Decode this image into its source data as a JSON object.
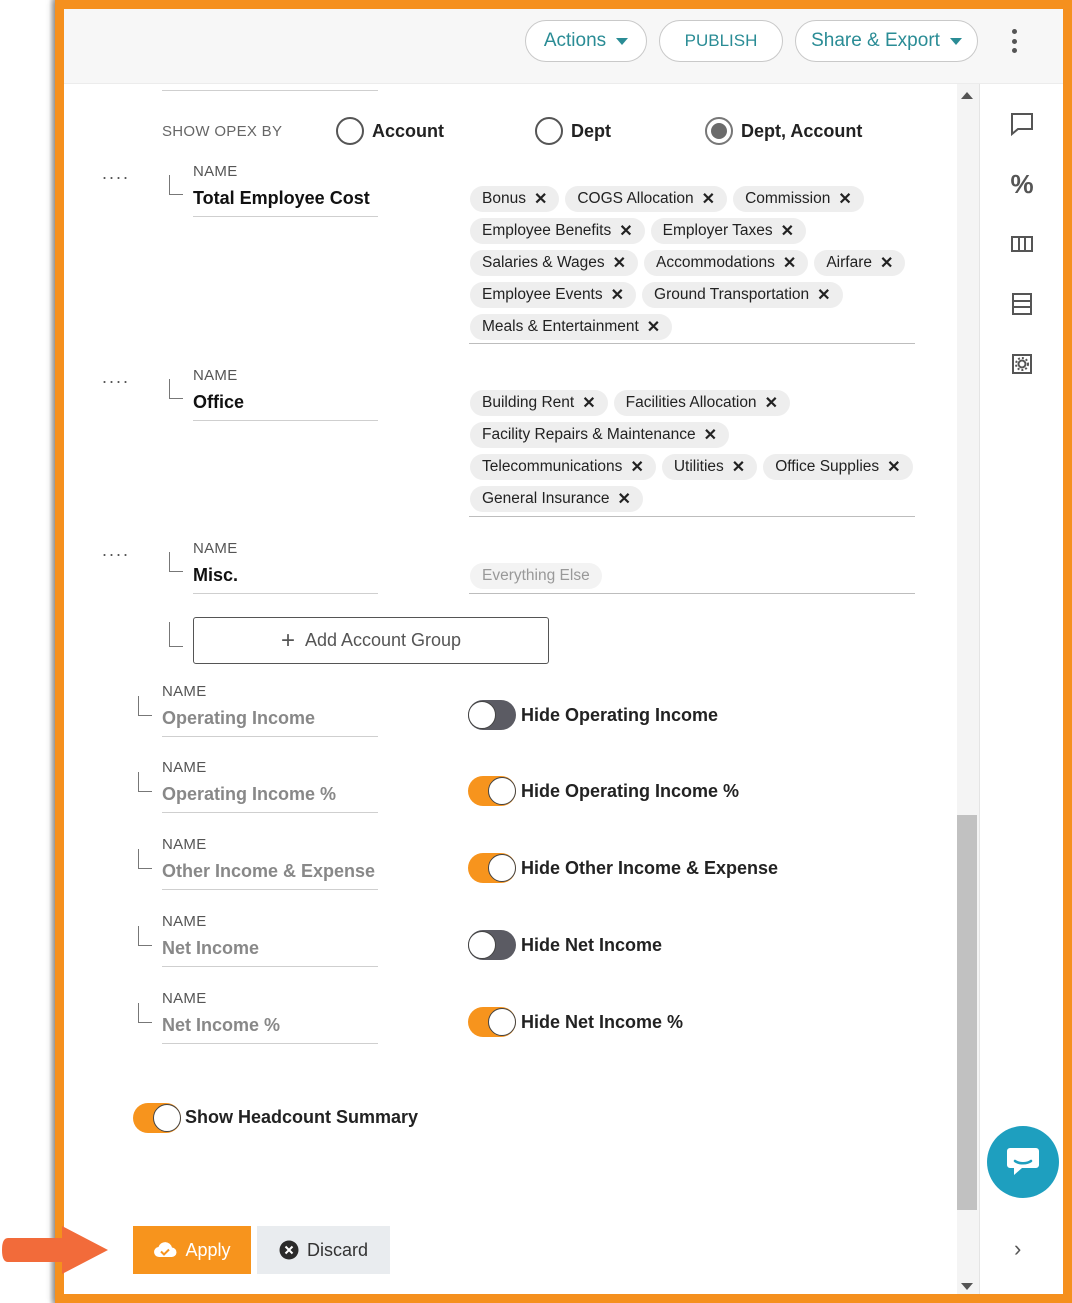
{
  "header": {
    "actions_label": "Actions",
    "publish_label": "PUBLISH",
    "share_export_label": "Share & Export"
  },
  "show_opex": {
    "label": "SHOW OPEX BY",
    "options": [
      "Account",
      "Dept",
      "Dept, Account"
    ],
    "selected": "Dept, Account"
  },
  "groups": [
    {
      "name_caption": "NAME",
      "name": "Total Employee Cost",
      "accounts": [
        "Bonus",
        "COGS Allocation",
        "Commission",
        "Employee Benefits",
        "Employer Taxes",
        "Salaries & Wages",
        "Accommodations",
        "Airfare",
        "Employee Events",
        "Ground Transportation",
        "Meals & Entertainment"
      ]
    },
    {
      "name_caption": "NAME",
      "name": "Office",
      "accounts": [
        "Building Rent",
        "Facilities Allocation",
        "Facility Repairs & Maintenance",
        "Telecommunications",
        "Utilities",
        "Office Supplies",
        "General Insurance"
      ]
    },
    {
      "name_caption": "NAME",
      "name": "Misc.",
      "placeholder": "Everything Else"
    }
  ],
  "add_group_label": "Add Account Group",
  "summary_rows": [
    {
      "caption": "NAME",
      "name": "Operating Income",
      "toggle_label": "Hide Operating Income",
      "on": false
    },
    {
      "caption": "NAME",
      "name": "Operating Income %",
      "toggle_label": "Hide Operating Income %",
      "on": true
    },
    {
      "caption": "NAME",
      "name": "Other Income & Expense",
      "toggle_label": "Hide Other Income & Expense",
      "on": true
    },
    {
      "caption": "NAME",
      "name": "Net Income",
      "toggle_label": "Hide Net Income",
      "on": false
    },
    {
      "caption": "NAME",
      "name": "Net Income %",
      "toggle_label": "Hide Net Income %",
      "on": true
    }
  ],
  "headcount": {
    "label": "Show Headcount Summary",
    "on": true
  },
  "footer": {
    "apply_label": "Apply",
    "discard_label": "Discard"
  },
  "colors": {
    "accent": "#f7941d",
    "teal": "#2a8c95",
    "chat": "#1e9fbf"
  },
  "icons": [
    "comment-icon",
    "percent-icon",
    "columns-icon",
    "rows-icon",
    "settings-icon",
    "chevron-right-icon",
    "chat-icon",
    "cloud-check-icon",
    "close-circle-icon",
    "plus-icon"
  ]
}
